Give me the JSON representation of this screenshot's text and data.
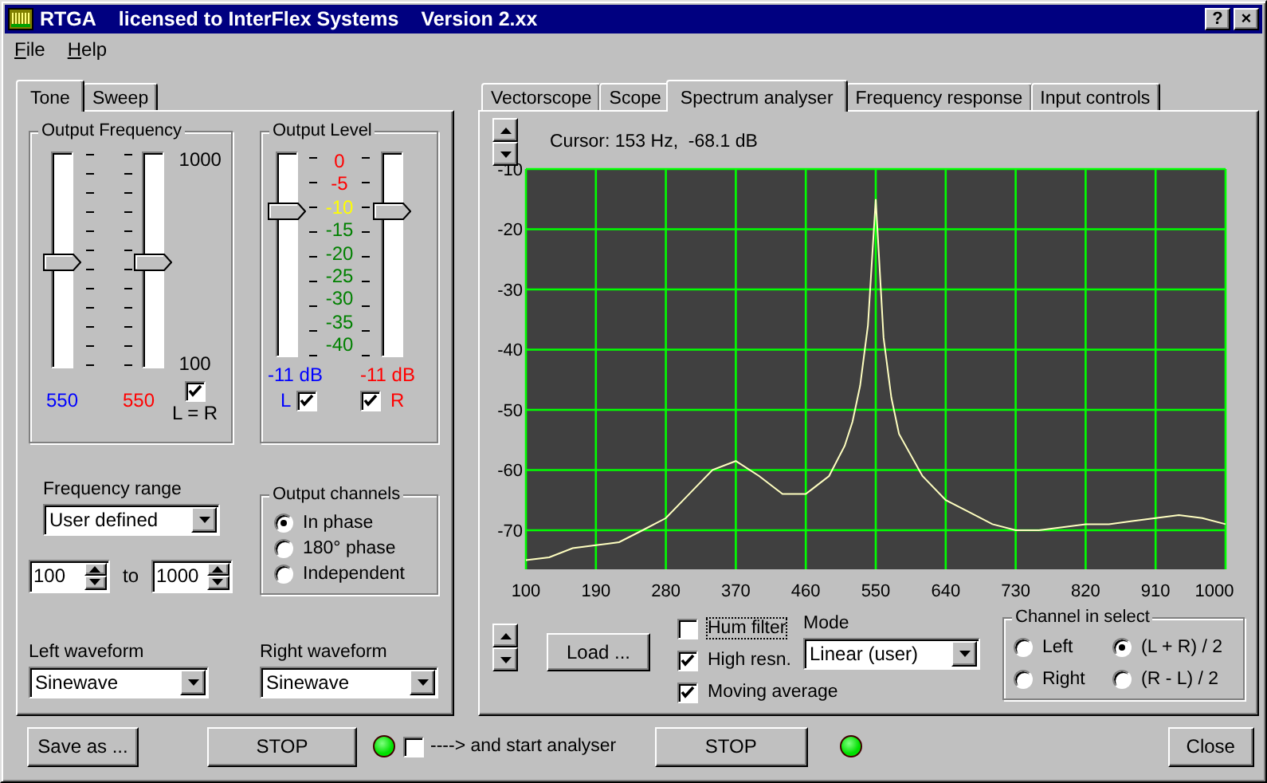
{
  "window": {
    "title_parts": [
      "RTGA",
      "licensed to InterFlex Systems",
      "Version 2.xx"
    ],
    "buttons": [
      "?",
      "×"
    ]
  },
  "menu": [
    {
      "label": "File"
    },
    {
      "label": "Help"
    }
  ],
  "left_tabs": [
    {
      "label": "Tone",
      "selected": true
    },
    {
      "label": "Sweep",
      "selected": false
    }
  ],
  "output_frequency": {
    "title": "Output Frequency",
    "sliders": [
      {
        "level": 0.49
      },
      {
        "level": 0.49
      }
    ],
    "max_label": "1000",
    "min_label": "100",
    "readings": [
      {
        "text": "550",
        "color": "#0000ff"
      },
      {
        "text": "550",
        "color": "#ff0000"
      }
    ],
    "link": {
      "label": "L = R",
      "checked": true
    }
  },
  "output_level": {
    "title": "Output Level",
    "sliders": [
      {
        "level": 0.73
      },
      {
        "level": 0.73
      }
    ],
    "scale": [
      {
        "label": "0",
        "color": "#ff0000"
      },
      {
        "label": "-5",
        "color": "#ff0000"
      },
      {
        "label": "-10",
        "color": "#ffff00"
      },
      {
        "label": "-15",
        "color": "#008000"
      },
      {
        "label": "-20",
        "color": "#008000"
      },
      {
        "label": "-25",
        "color": "#008000"
      },
      {
        "label": "-30",
        "color": "#008000"
      },
      {
        "label": "-35",
        "color": "#008000"
      },
      {
        "label": "-40",
        "color": "#008000"
      }
    ],
    "readings": [
      {
        "text": "-11 dB",
        "color": "#0000ff"
      },
      {
        "text": "-11 dB",
        "color": "#ff0000"
      }
    ],
    "channels": [
      {
        "label": "L",
        "checked": true,
        "color": "#0000ff"
      },
      {
        "label": "R",
        "checked": true,
        "color": "#ff0000"
      }
    ]
  },
  "frequency_range": {
    "label": "Frequency range",
    "value": "User defined",
    "from": "100",
    "to_label": "to",
    "to": "1000"
  },
  "output_channels": {
    "title": "Output channels",
    "options": [
      {
        "label": "In phase",
        "selected": true
      },
      {
        "label": "180° phase",
        "selected": false
      },
      {
        "label": "Independent",
        "selected": false
      }
    ]
  },
  "waveforms": [
    {
      "label": "Left waveform",
      "value": "Sinewave"
    },
    {
      "label": "Right waveform",
      "value": "Sinewave"
    }
  ],
  "right_tabs": [
    {
      "label": "Vectorscope",
      "selected": false
    },
    {
      "label": "Scope",
      "selected": false
    },
    {
      "label": "Spectrum analyser",
      "selected": true
    },
    {
      "label": "Frequency response",
      "selected": false
    },
    {
      "label": "Input controls",
      "selected": false
    }
  ],
  "cursor_readout": "Cursor: 153 Hz,  -68.1 dB",
  "spectrum": {
    "chart_data": {
      "type": "line",
      "x": [
        100,
        130,
        160,
        190,
        220,
        250,
        280,
        310,
        340,
        370,
        400,
        430,
        460,
        490,
        510,
        520,
        530,
        540,
        550,
        560,
        570,
        580,
        610,
        640,
        670,
        700,
        730,
        760,
        790,
        820,
        850,
        880,
        910,
        940,
        970,
        1000
      ],
      "series": [
        {
          "color": "#ffffc0",
          "values": [
            -75,
            -74.5,
            -73,
            -72.5,
            -72,
            -70,
            -68,
            -64,
            -60,
            -58.5,
            -61,
            -64,
            -64,
            -61,
            -56,
            -52,
            -46,
            -36,
            -15,
            -38,
            -48,
            -54,
            -61,
            -65,
            -67,
            -69,
            -70,
            -70,
            -69.5,
            -69,
            -69,
            -68.5,
            -68,
            -67.5,
            -68,
            -69
          ]
        }
      ],
      "grid": true,
      "xlim": [
        100,
        1000
      ],
      "ylim": [
        -76.5,
        -10
      ],
      "xticks": [
        100,
        190,
        280,
        370,
        460,
        550,
        640,
        730,
        820,
        910,
        1000
      ],
      "yticks": [
        -10,
        -20,
        -30,
        -40,
        -50,
        -60,
        -70
      ]
    }
  },
  "load_button": "Load ...",
  "options": [
    {
      "label": "Hum filter",
      "checked": false,
      "focused": true
    },
    {
      "label": "High resn.",
      "checked": true,
      "focused": false
    },
    {
      "label": "Moving average",
      "checked": true,
      "focused": false
    }
  ],
  "mode": {
    "label": "Mode",
    "value": "Linear (user)"
  },
  "channel_in_select": {
    "title": "Channel in select",
    "options": [
      {
        "label": "Left",
        "selected": false
      },
      {
        "label": "(L + R) / 2",
        "selected": true
      },
      {
        "label": "Right",
        "selected": false
      },
      {
        "label": "(R - L) / 2",
        "selected": false
      }
    ]
  },
  "footer": [
    {
      "kind": "button",
      "label": "Save as ..."
    },
    {
      "kind": "button",
      "label": "STOP"
    },
    {
      "kind": "led",
      "on": true
    },
    {
      "kind": "checkbox",
      "label": "----> and start analyser",
      "checked": false
    },
    {
      "kind": "button",
      "label": "STOP"
    },
    {
      "kind": "led",
      "on": true
    },
    {
      "kind": "button",
      "label": "Close"
    }
  ]
}
